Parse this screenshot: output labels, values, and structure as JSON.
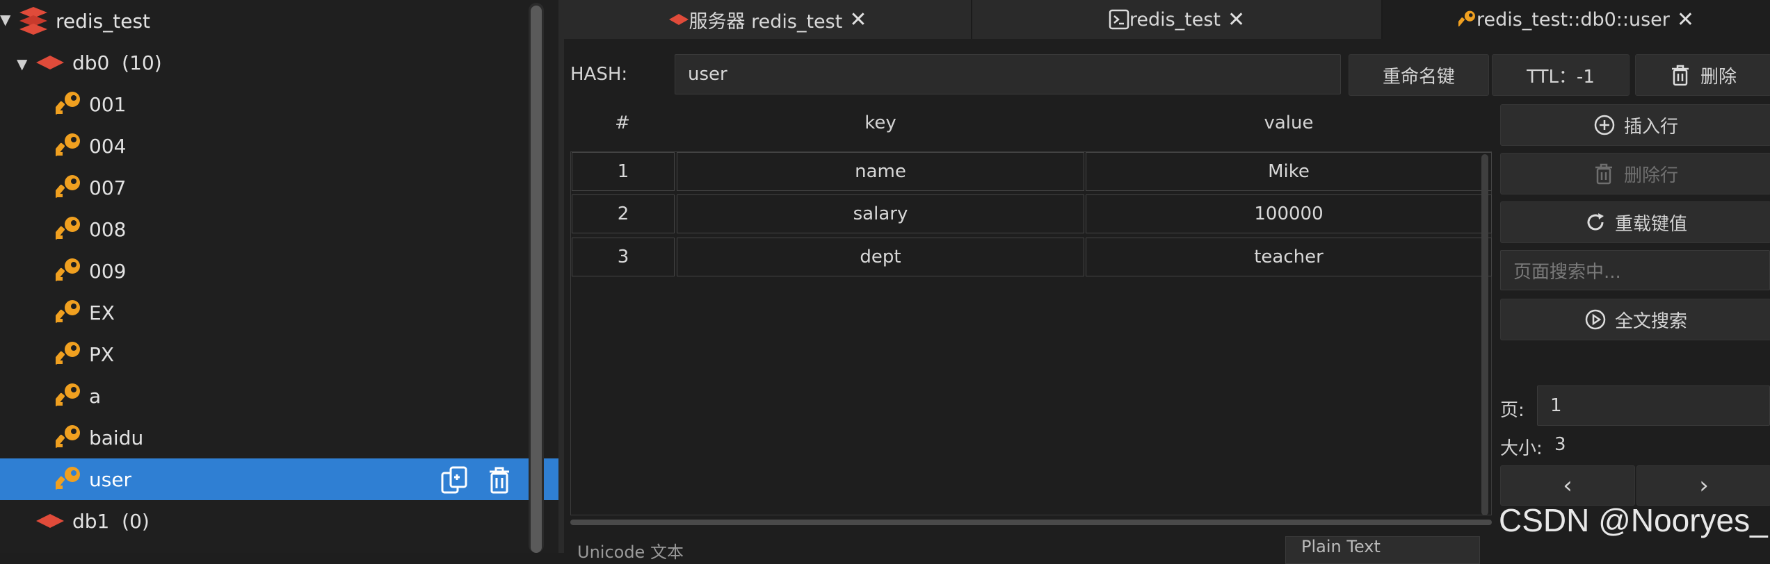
{
  "sidebar": {
    "connection": "redis_test",
    "db0_label": "db0  (10)",
    "keys": [
      "001",
      "004",
      "007",
      "008",
      "009",
      "EX",
      "PX",
      "a",
      "baidu",
      "user"
    ],
    "selected_key": "user",
    "db1_label": "db1  (0)"
  },
  "tabs": [
    {
      "label": "服务器 redis_test",
      "icon": "server-icon"
    },
    {
      "label": "redis_test",
      "icon": "terminal-icon"
    },
    {
      "label": "redis_test::db0::user",
      "icon": "key-icon"
    }
  ],
  "header": {
    "type_label": "HASH:",
    "key_name": "user",
    "rename_label": "重命名键",
    "ttl_label": "TTL：-1",
    "delete_label": "删除"
  },
  "table": {
    "columns": [
      "#",
      "key",
      "value"
    ],
    "rows": [
      {
        "index": "1",
        "key": "name",
        "value": "Mike"
      },
      {
        "index": "2",
        "key": "salary",
        "value": "100000"
      },
      {
        "index": "3",
        "key": "dept",
        "value": "teacher"
      }
    ]
  },
  "actions": {
    "insert_row": "插入行",
    "delete_row": "删除行",
    "reload": "重载键值",
    "search_placeholder": "页面搜索中...",
    "fulltext_search": "全文搜索",
    "page_label": "页:",
    "page_value": "1",
    "size_label": "大小:",
    "size_value": "3",
    "prev": "‹",
    "next": "›"
  },
  "footer": {
    "hint": "Unicode 文本",
    "format": "Plain Text"
  },
  "watermark": "CSDN @Nooryes_",
  "colors": {
    "selection": "#2f7fd3",
    "key_icon": "#f0a020",
    "redis_red": "#e04b3a"
  }
}
